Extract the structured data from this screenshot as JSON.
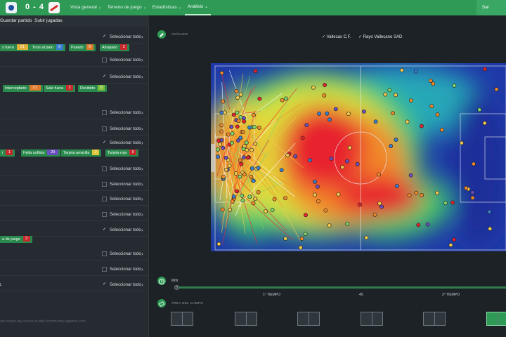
{
  "header": {
    "score": "0 - 4",
    "nav": [
      {
        "label": "Vista general"
      },
      {
        "label": "Terreno de juego"
      },
      {
        "label": "Estadísticas"
      },
      {
        "label": "Análisis",
        "active": true
      }
    ],
    "right_label": "Sal"
  },
  "toolbar": {
    "save_label": "Guardar partido",
    "upload_label": "Subir jugadas"
  },
  "filters": {
    "select_all_label": "Seleccionar todo",
    "rows": [
      {
        "checked": true,
        "chips": [
          {
            "label": "s fuera",
            "value": "21",
            "color": "#e0b13a"
          },
          {
            "label": "Tiros al palo",
            "value": "0",
            "color": "#3a7fd0"
          },
          {
            "label": "Parado",
            "value": "6",
            "color": "#e07a2c"
          },
          {
            "label": "Atrapado",
            "value": "2",
            "color": "#c8282b"
          }
        ]
      },
      {
        "checked": false,
        "chips": []
      },
      {
        "checked": true,
        "chips": [
          {
            "label": "Interceptado",
            "value": "21",
            "color": "#e07a2c"
          },
          {
            "label": "Sale fuera",
            "value": "2",
            "color": "#c8282b"
          },
          {
            "label": "Recibido",
            "value": "6",
            "color": "#7fbf3a"
          }
        ]
      },
      {
        "checked": false,
        "chips": []
      },
      {
        "checked": false,
        "chips": []
      },
      {
        "checked": true,
        "chips": [
          {
            "label": "i",
            "value": "1",
            "color": "#c8282b"
          },
          {
            "label": "Falta sufrida",
            "value": "20",
            "color": "#6a4fc0"
          },
          {
            "label": "Tarjeta amarilla",
            "value": "2",
            "color": "#e0c43a"
          },
          {
            "label": "Tarjeta roja",
            "value": "0",
            "color": "#c8282b"
          }
        ]
      },
      {
        "checked": false,
        "chips": []
      },
      {
        "checked": false,
        "chips": []
      },
      {
        "checked": false,
        "chips": []
      },
      {
        "checked": false,
        "chips": []
      },
      {
        "checked": true,
        "chips": [
          {
            "label": "a de juego",
            "value": "3",
            "color": "#c8282b"
          }
        ]
      },
      {
        "checked": false,
        "chips": []
      },
      {
        "checked": false,
        "chips": []
      },
      {
        "checked": true,
        "chips": [],
        "left_label": "L"
      }
    ],
    "footer": "ase report any issues at http://community.sigames.com"
  },
  "analysis": {
    "section_label": "ANÁLISIS",
    "legend": [
      {
        "label": "Vallecas C.F.",
        "checked": true
      },
      {
        "label": "Rayo Vallecano SAD",
        "checked": true
      }
    ]
  },
  "timeline": {
    "label_min": "MIN",
    "min_value": "0",
    "first_half": "1º TIEMPO",
    "mid_value": "45",
    "second_half": "2º TIEMPO"
  },
  "field_area": {
    "label": "ÁREA DEL CAMPO"
  },
  "colors": {
    "accent": "#2e9a56",
    "panel": "#252b30",
    "background": "#1d2226"
  },
  "icons": {
    "pencil": "pencil-icon",
    "clock": "clock-icon",
    "pitch": "pitch-icon"
  }
}
